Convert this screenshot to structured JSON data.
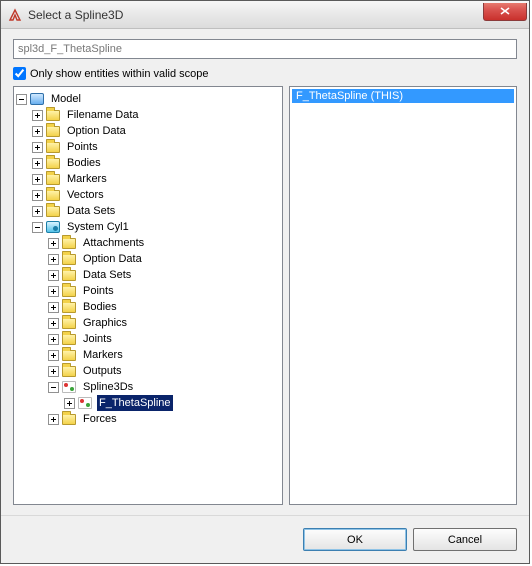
{
  "window": {
    "title": "Select a Spline3D",
    "close_tooltip": "Close"
  },
  "input": {
    "value": "spl3d_F_ThetaSpline"
  },
  "scope_checkbox": {
    "checked": true,
    "label": "Only show entities within valid scope"
  },
  "tree": {
    "root": {
      "label": "Model",
      "children": [
        {
          "label": "Filename Data"
        },
        {
          "label": "Option Data"
        },
        {
          "label": "Points"
        },
        {
          "label": "Bodies"
        },
        {
          "label": "Markers"
        },
        {
          "label": "Vectors"
        },
        {
          "label": "Data Sets"
        }
      ],
      "system": {
        "label": "System Cyl1",
        "children": [
          {
            "label": "Attachments"
          },
          {
            "label": "Option Data"
          },
          {
            "label": "Data Sets"
          },
          {
            "label": "Points"
          },
          {
            "label": "Bodies"
          },
          {
            "label": "Graphics"
          },
          {
            "label": "Joints"
          },
          {
            "label": "Markers"
          },
          {
            "label": "Outputs"
          }
        ],
        "splines": {
          "label": "Spline3Ds",
          "selected_child": {
            "label": "F_ThetaSpline"
          }
        },
        "forces": {
          "label": "Forces"
        }
      }
    }
  },
  "list": {
    "items": [
      {
        "label": "F_ThetaSpline (THIS)",
        "selected": true
      }
    ]
  },
  "buttons": {
    "ok": "OK",
    "cancel": "Cancel"
  }
}
